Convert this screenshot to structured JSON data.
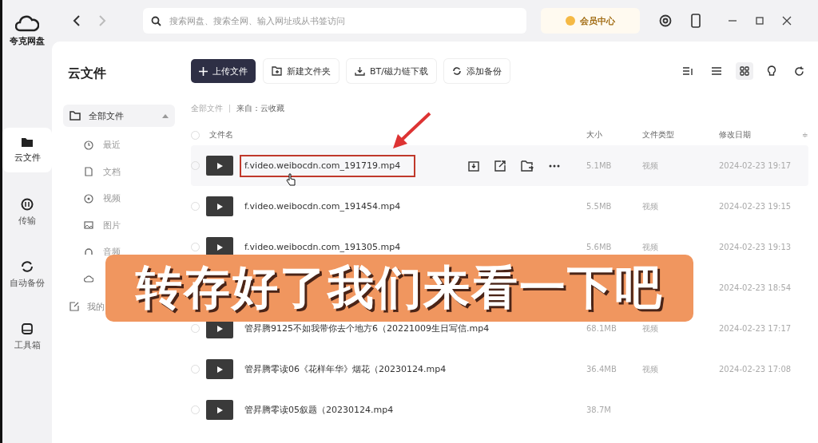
{
  "app": {
    "name": "夸克网盘"
  },
  "rail": [
    {
      "label": "云文件",
      "selected": true
    },
    {
      "label": "传输",
      "selected": false
    },
    {
      "label": "自动备份",
      "selected": false
    },
    {
      "label": "工具箱",
      "selected": false
    }
  ],
  "search": {
    "placeholder": "搜索网盘、搜索全网、输入网址或从书签访问"
  },
  "vip_button": "会员中心",
  "page_title": "云文件",
  "sidebar": {
    "root": {
      "label": "全部文件",
      "expanded": true
    },
    "items": [
      {
        "label": "最近",
        "kind": "recent"
      },
      {
        "label": "文档",
        "kind": "document"
      },
      {
        "label": "视频",
        "kind": "video"
      },
      {
        "label": "图片",
        "kind": "image"
      },
      {
        "label": "音频",
        "kind": "audio"
      },
      {
        "kind": "cloud"
      }
    ],
    "extra": {
      "label": "我的"
    }
  },
  "toolbar": [
    {
      "label": "上传文件",
      "kind": "primary"
    },
    {
      "label": "新建文件夹",
      "kind": "folder"
    },
    {
      "label": "BT/磁力链下载",
      "kind": "download"
    },
    {
      "label": "添加备份",
      "kind": "backup"
    }
  ],
  "view_mode": {
    "grid": true
  },
  "breadcrumb": [
    "全部文件",
    "来自：云收藏"
  ],
  "columns": {
    "name": "文件名",
    "size": "大小",
    "type": "文件类型",
    "date": "修改日期",
    "sort_icon": "≑",
    "select_all": {
      "checked": false
    }
  },
  "rows": [
    {
      "name": "f.video.weibocdn.com_191719.mp4",
      "size": "5.1MB",
      "type": "视频",
      "date": "2024-02-23 19:17",
      "hovered": true,
      "checked": false,
      "annotated": true
    },
    {
      "name": "f.video.weibocdn.com_191454.mp4",
      "size": "5.5MB",
      "type": "视频",
      "date": "2024-02-23 19:15",
      "hovered": false,
      "checked": false,
      "annotated": false
    },
    {
      "name": "f.video.weibocdn.com_191305.mp4",
      "size": "5.6MB",
      "type": "视频",
      "date": "2024-02-23 19:13",
      "hovered": false,
      "checked": false,
      "annotated": false
    },
    {
      "date": "2024-02-23 18:54"
    },
    {
      "name": "管昇腾9125不如我带你去个地方6（20221009生日写信.mp4",
      "size": "68.1MB",
      "type": "视频",
      "date": "2024-02-23 17:17",
      "hovered": false,
      "checked": false,
      "annotated": false
    },
    {
      "name": "管昇腾零读06《花样年华》烟花（20230124.mp4",
      "size": "36.4MB",
      "type": "视频",
      "date": "2024-02-23 17:08",
      "hovered": false,
      "checked": false,
      "annotated": false
    },
    {
      "name": "管昇腾零读05叙题（20230124.mp4",
      "size": "38.7M",
      "hovered": false,
      "checked": false,
      "annotated": false
    }
  ],
  "caption": "转存好了我们来看一下吧"
}
